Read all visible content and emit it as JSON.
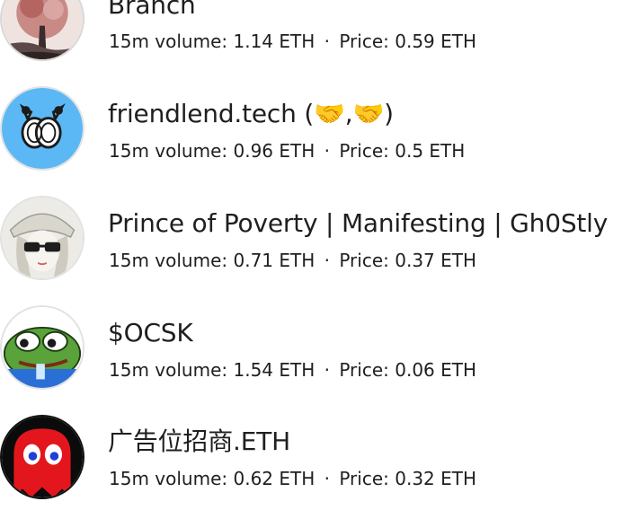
{
  "volume_label": "15m volume:",
  "price_label": "Price:",
  "separator": "·",
  "users": [
    {
      "name": "Branch",
      "volume": "1.14 ETH",
      "price": "0.59 ETH",
      "avatar_icon": "branch-tree-avatar-icon"
    },
    {
      "name": "friendlend.tech (🤝,🤝)",
      "volume": "0.96 ETH",
      "price": "0.5 ETH",
      "avatar_icon": "coin-logo-avatar-icon"
    },
    {
      "name": "Prince of Poverty | Manifesting | Gh0Stly",
      "volume": "0.71 ETH",
      "price": "0.37 ETH",
      "avatar_icon": "anime-girl-avatar-icon"
    },
    {
      "name": "$OCSK",
      "volume": "1.54 ETH",
      "price": "0.06 ETH",
      "avatar_icon": "pepe-frog-avatar-icon"
    },
    {
      "name": "广告位招商.ETH",
      "volume": "0.62 ETH",
      "price": "0.32 ETH",
      "avatar_icon": "ghost-avatar-icon"
    }
  ]
}
